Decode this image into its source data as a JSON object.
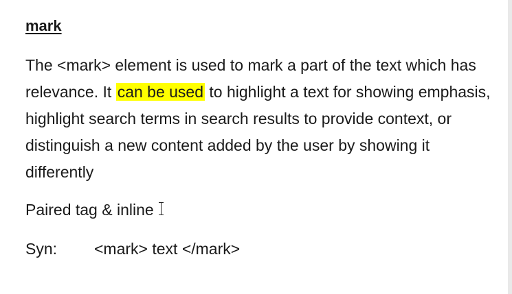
{
  "slide": {
    "heading": "mark",
    "paragraph": {
      "before_highlight": "The <mark> element is used to mark a part of the text which has relevance. It ",
      "highlight": "can be used",
      "after_highlight": " to highlight a text for showing emphasis, highlight search terms in search results to provide context, or distinguish a new content added by the user by showing it differently"
    },
    "paired_note": "Paired tag & inline",
    "syntax_label": "Syn:",
    "syntax_code": "<mark> text </mark>"
  },
  "colors": {
    "highlight": "#ffff00",
    "text": "#1a1a1a",
    "background": "#ffffff"
  },
  "icons": {
    "cursor": "text-cursor-icon"
  }
}
